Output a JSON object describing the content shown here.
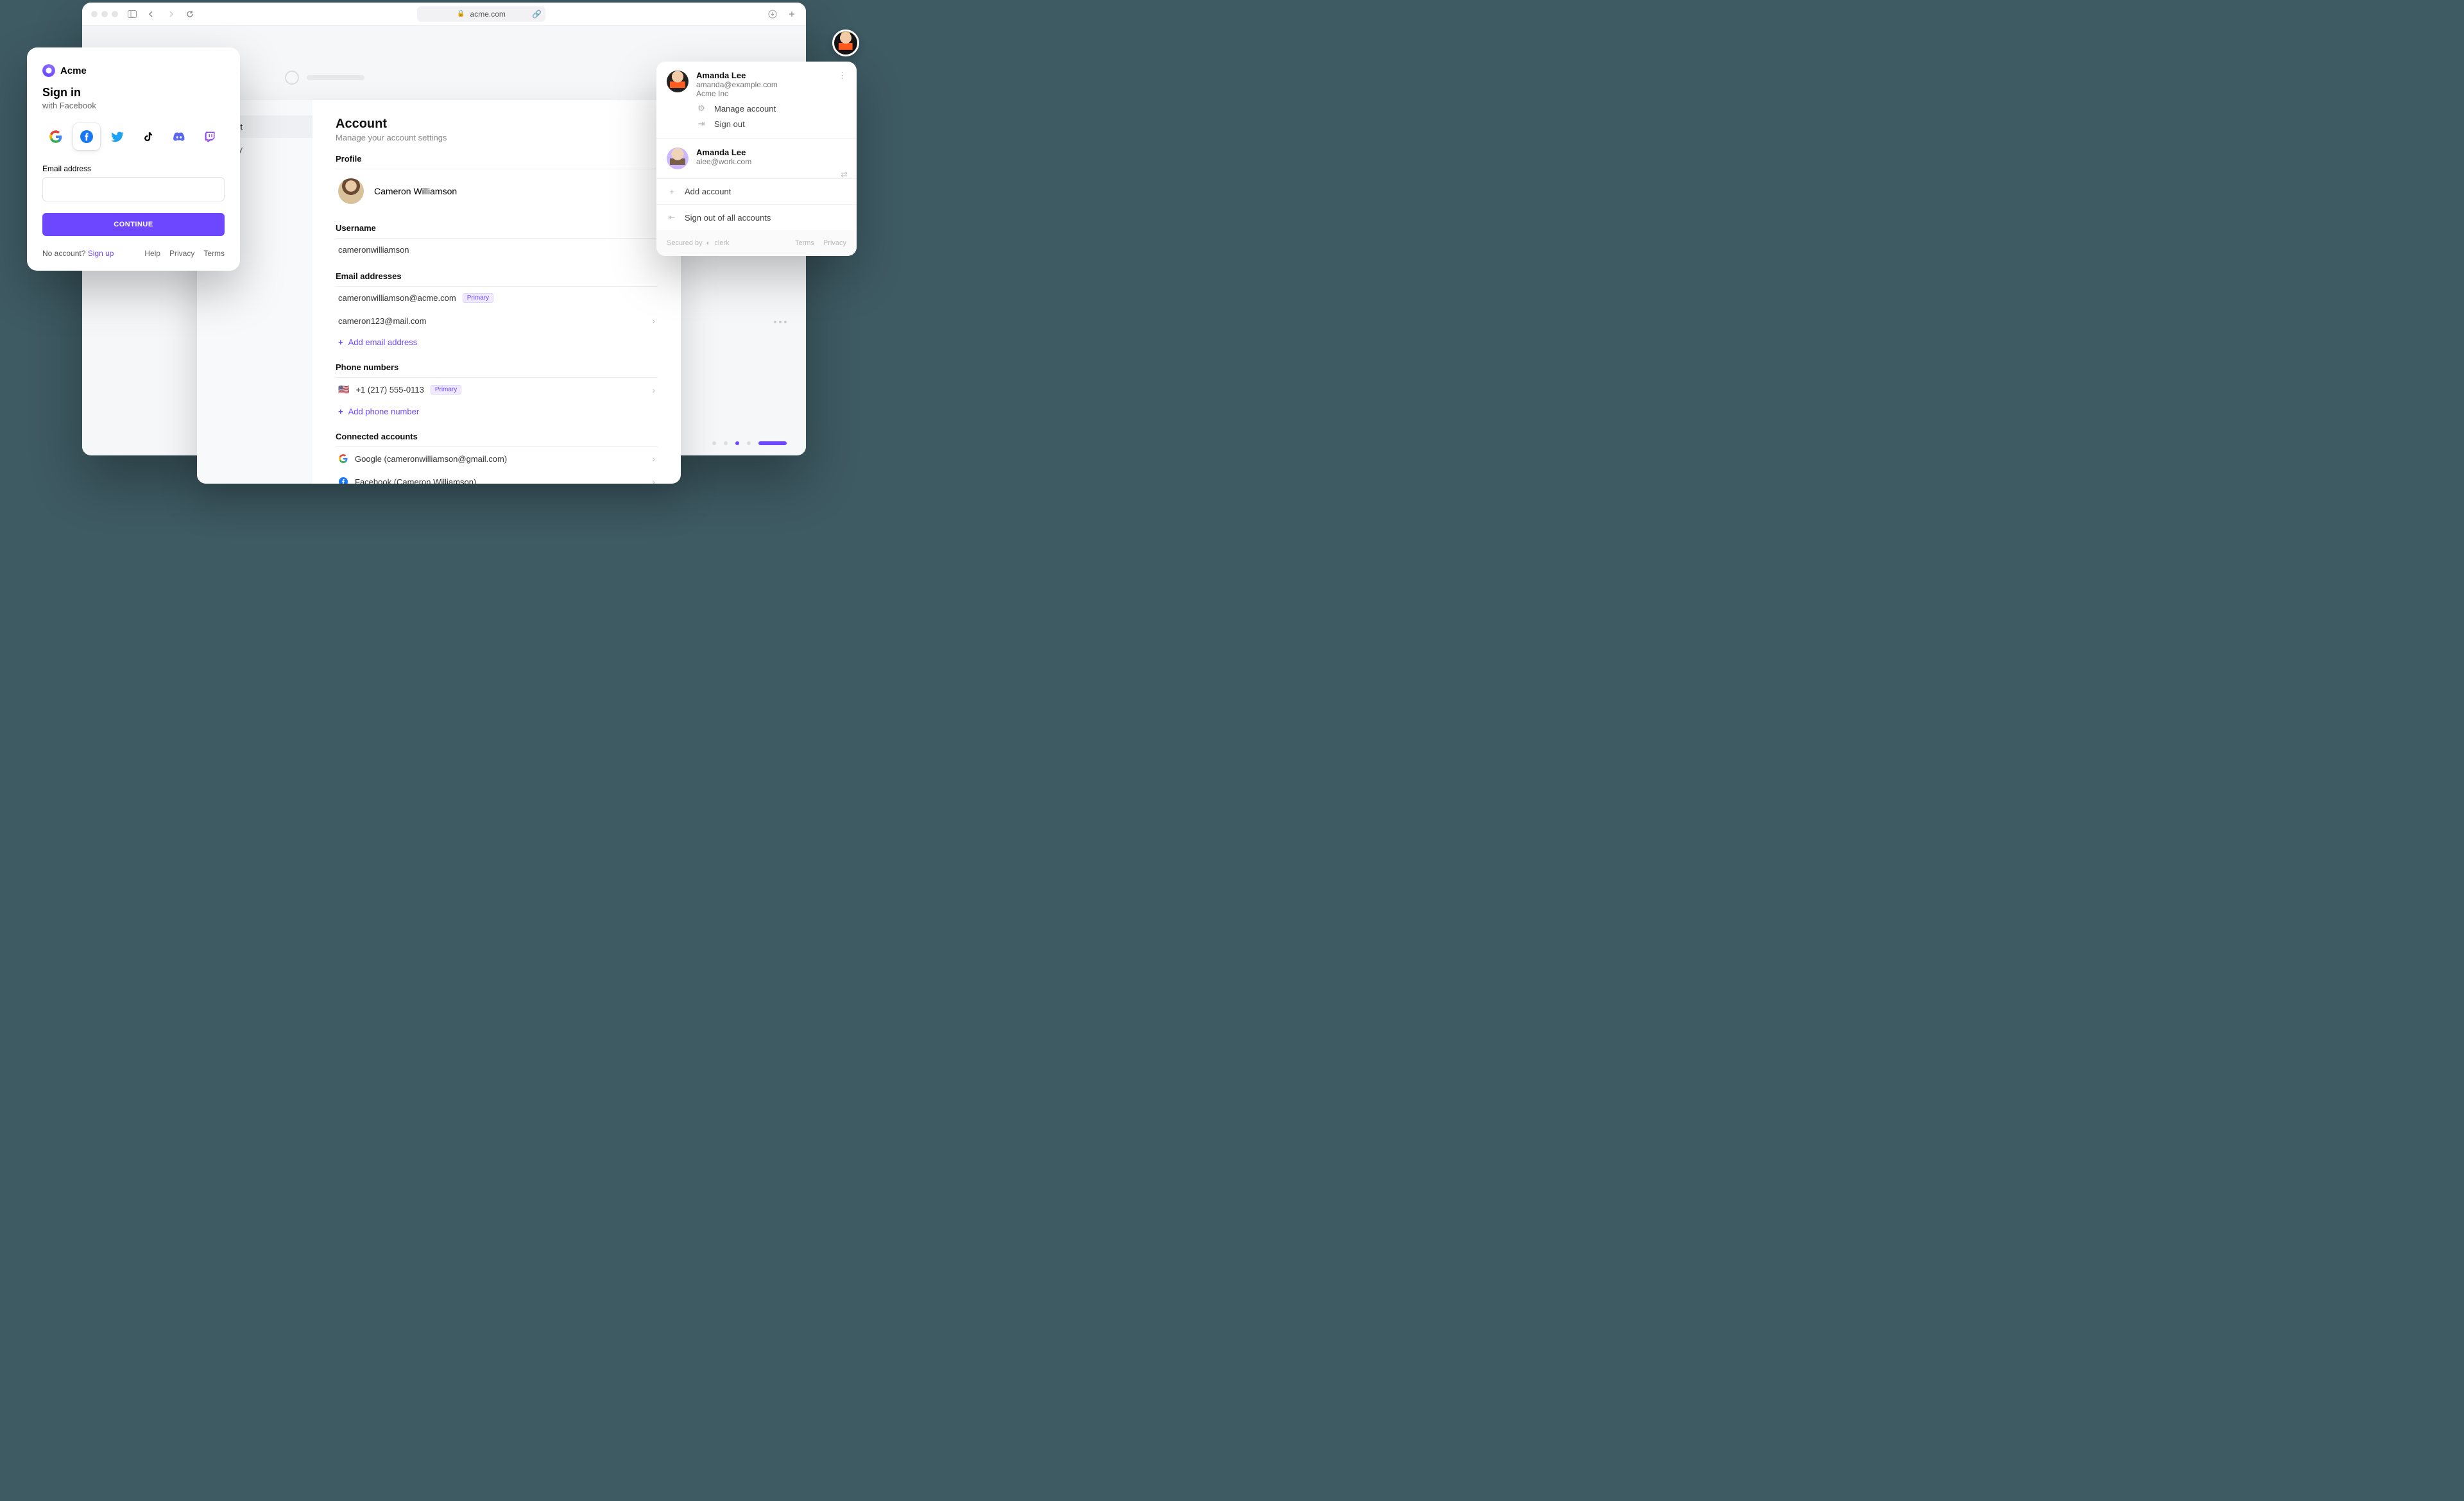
{
  "browser": {
    "url_host": "acme.com"
  },
  "signin": {
    "brand": "Acme",
    "title": "Sign in",
    "subtitle": "with Facebook",
    "email_label": "Email address",
    "email_value": "",
    "continue": "CONTINUE",
    "no_account": "No account?",
    "signup": "Sign up",
    "help": "Help",
    "privacy": "Privacy",
    "terms": "Terms",
    "providers": [
      "google",
      "facebook",
      "twitter",
      "tiktok",
      "discord",
      "twitch"
    ]
  },
  "settings": {
    "nav": {
      "account": "Account",
      "security": "Security"
    },
    "title": "Account",
    "subtitle": "Manage your account settings",
    "profile_label": "Profile",
    "profile_name": "Cameron Williamson",
    "username_label": "Username",
    "username_value": "cameronwilliamson",
    "emails_label": "Email addresses",
    "emails": [
      {
        "address": "cameronwilliamson@acme.com",
        "primary": true
      },
      {
        "address": "cameron123@mail.com",
        "primary": false
      }
    ],
    "primary_badge": "Primary",
    "add_email": "Add email address",
    "phones_label": "Phone numbers",
    "phone": {
      "number": "+1 (217) 555-0113",
      "primary": true
    },
    "add_phone": "Add phone number",
    "connected_label": "Connected accounts",
    "connected": [
      {
        "provider": "google",
        "label": "Google (cameronwilliamson@gmail.com)"
      },
      {
        "provider": "facebook",
        "label": "Facebook (Cameron Williamson)"
      }
    ]
  },
  "switcher": {
    "primary": {
      "name": "Amanda Lee",
      "email": "amanda@example.com",
      "org": "Acme Inc"
    },
    "manage": "Manage account",
    "signout": "Sign out",
    "secondary": {
      "name": "Amanda Lee",
      "email": "alee@work.com"
    },
    "add_account": "Add account",
    "signout_all": "Sign out of all accounts",
    "secured_by": "Secured by",
    "clerk": "clerk",
    "terms": "Terms",
    "privacy": "Privacy"
  }
}
